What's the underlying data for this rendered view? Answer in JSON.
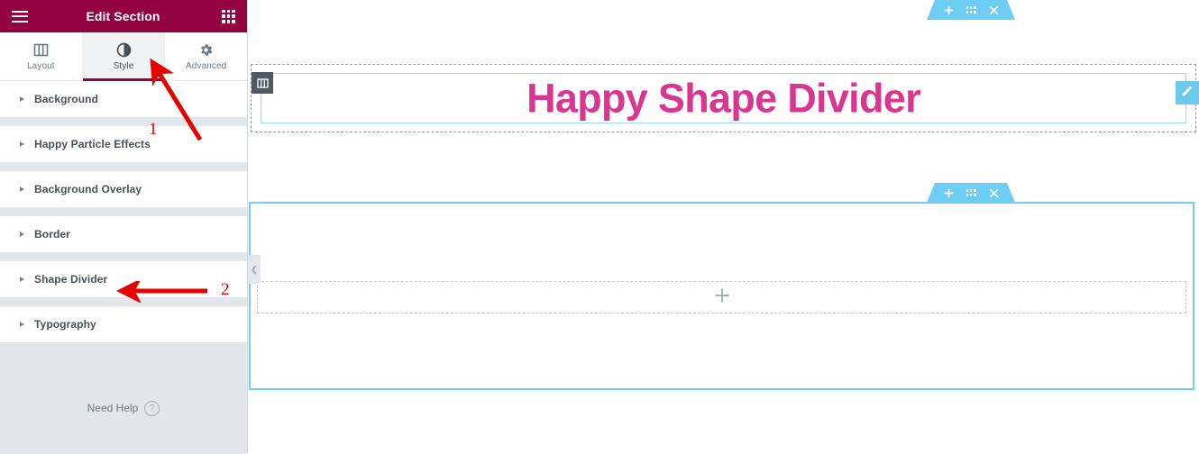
{
  "panel": {
    "header": {
      "title": "Edit Section",
      "menu_icon": "hamburger-icon",
      "apps_icon": "grid-apps-icon"
    },
    "tabs": [
      {
        "label": "Layout",
        "icon": "layout-columns-icon",
        "active": false
      },
      {
        "label": "Style",
        "icon": "contrast-circle-icon",
        "active": true
      },
      {
        "label": "Advanced",
        "icon": "gear-icon",
        "active": false
      }
    ],
    "sections": [
      {
        "label": "Background"
      },
      {
        "label": "Happy Particle Effects"
      },
      {
        "label": "Background Overlay"
      },
      {
        "label": "Border"
      },
      {
        "label": "Shape Divider"
      },
      {
        "label": "Typography"
      }
    ],
    "footer": {
      "need_help_label": "Need Help",
      "help_icon": "question-circle-icon"
    },
    "collapse_icon": "chevron-left-icon",
    "colors": {
      "header_bg": "#930342",
      "active_tab_underline": "#930342",
      "panel_bg": "#e3e7eb"
    }
  },
  "canvas": {
    "section1": {
      "heading": "Happy Shape Divider",
      "heading_color": "#d8368f",
      "column_handle_icon": "column-handle-icon",
      "edit_icon": "pencil-edit-icon",
      "controls": {
        "add_icon": "plus-icon",
        "drag_icon": "drag-dots-icon",
        "close_icon": "close-x-icon"
      }
    },
    "section2": {
      "drop_placeholder_icon": "plus-icon",
      "controls": {
        "add_icon": "plus-icon",
        "drag_icon": "drag-dots-icon",
        "close_icon": "close-x-icon"
      },
      "border_color": "#71cdf2"
    }
  },
  "annotations": [
    {
      "number": "1",
      "target": "Style tab",
      "color": "#e60000"
    },
    {
      "number": "2",
      "target": "Shape Divider",
      "color": "#e60000"
    }
  ]
}
